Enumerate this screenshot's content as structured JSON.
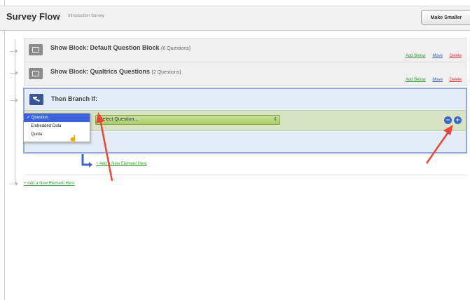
{
  "header": {
    "title": "Survey Flow",
    "subtitle": "Introduction Survey",
    "make_smaller": "Make Smaller"
  },
  "blocks": [
    {
      "label": "Show Block: Default Question Block",
      "count": "(6 Questions)"
    },
    {
      "label": "Show Block: Qualtrics Questions",
      "count": "(2 Questions)"
    }
  ],
  "actions": {
    "add_below": "Add Below",
    "move": "Move",
    "delete": "Delete"
  },
  "branch": {
    "title": "Then Branch If:",
    "select_placeholder": "Select Question...",
    "select_arrows": "⇕",
    "minus": "−",
    "plus": "+"
  },
  "dropdown": {
    "options": [
      "✓ Question",
      "Embedded Data",
      "Quota"
    ],
    "selected": "Question"
  },
  "add_new_element": "+ Add a New Element Here",
  "colors": {
    "accent_blue": "#3a63d7",
    "condition_green": "#a9cd6a",
    "annotation_red": "#e8473a",
    "link_green": "#3a9a3a"
  }
}
